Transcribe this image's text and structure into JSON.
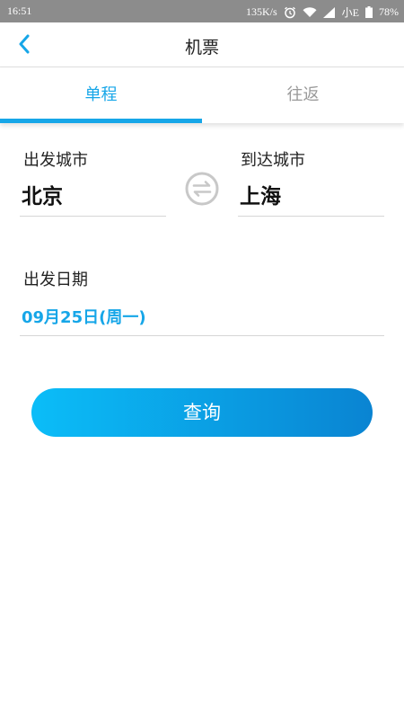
{
  "status_bar": {
    "time": "16:51",
    "net_speed": "135K/s",
    "carrier": "小E",
    "battery": "78%",
    "icons": [
      "alarm-icon",
      "wifi-icon",
      "signal-icon",
      "battery-icon"
    ]
  },
  "header": {
    "back_icon": "chevron-left-icon",
    "title": "机票"
  },
  "tabs": [
    {
      "label": "单程",
      "active": true
    },
    {
      "label": "往返",
      "active": false
    }
  ],
  "form": {
    "departure_label": "出发城市",
    "departure_city": "北京",
    "arrival_label": "到达城市",
    "arrival_city": "上海",
    "swap_icon": "swap-icon",
    "date_label": "出发日期",
    "date_value": "09月25日(周一)"
  },
  "search_button": "查询",
  "colors": {
    "accent": "#16a6e8",
    "button_gradient_start": "#0bbdf8",
    "button_gradient_end": "#0a84d2",
    "status_bar": "#8c8c8c"
  }
}
